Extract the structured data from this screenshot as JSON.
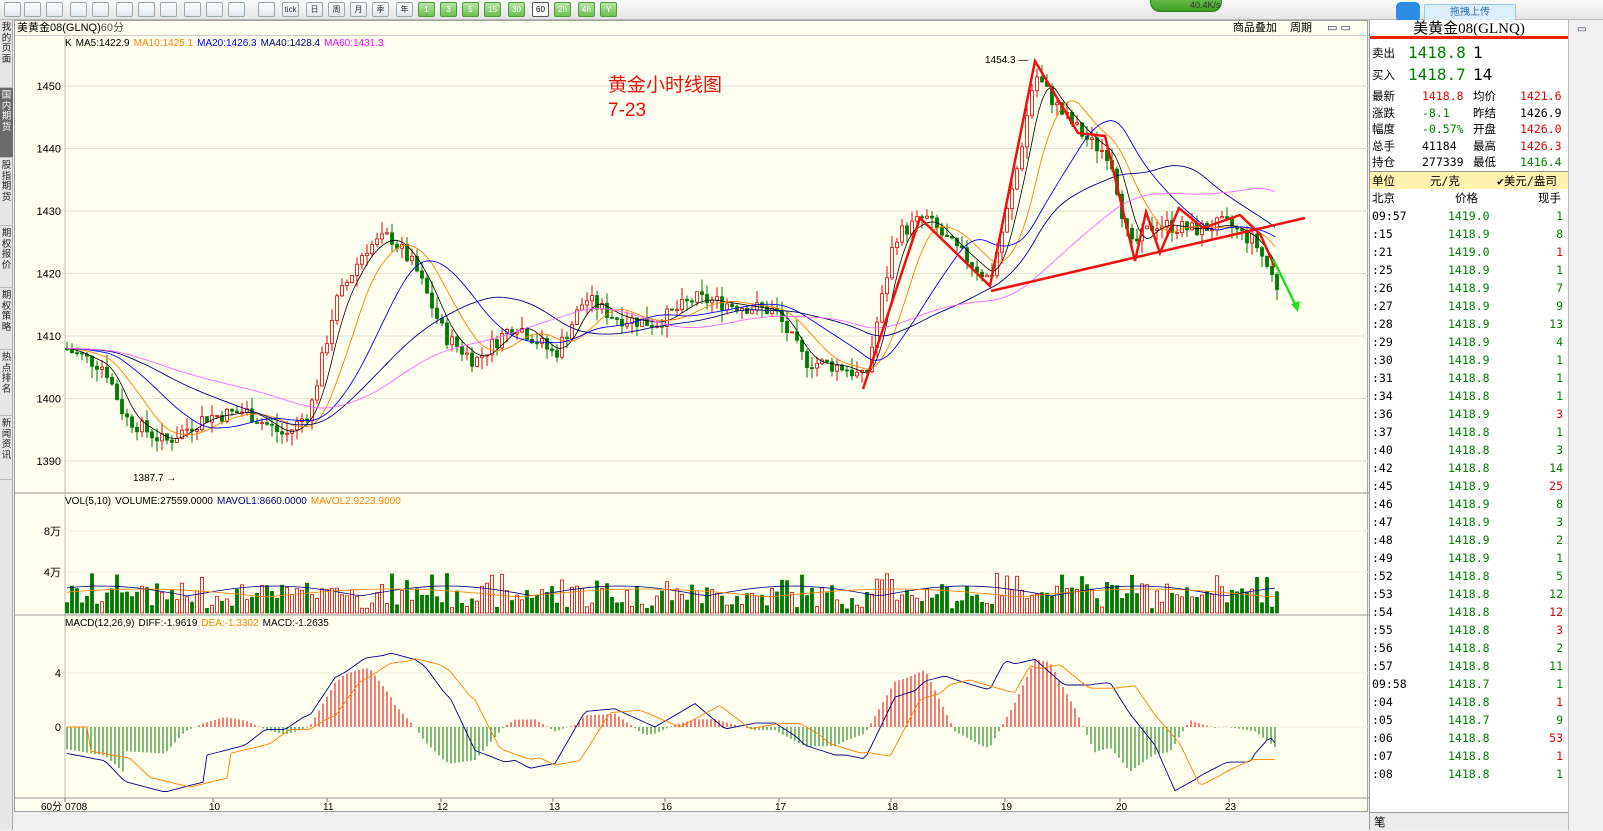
{
  "toolbar": {
    "buttons": [
      "back",
      "home",
      "page",
      "refresh",
      "zoom-in",
      "zoom-out",
      "layers",
      "draw",
      "paint",
      "filter",
      "list",
      "chart",
      "tick",
      "日",
      "周",
      "月",
      "季",
      "年",
      "1",
      "3",
      "5",
      "15",
      "30",
      "60",
      "2h",
      "4h",
      "Y"
    ],
    "speed": "40.4K/s",
    "upload": "拖拽上传"
  },
  "sidebar": [
    "我的页面",
    "国内期货",
    "股指期货",
    "期权报价",
    "期权策略",
    "热点排名",
    "新闻资讯"
  ],
  "header": {
    "title": "美黄金08(GLNQ)",
    "period": "60分",
    "right1": "商品叠加",
    "right2": "周期"
  },
  "legend_main": [
    {
      "t": "K",
      "c": "#000000"
    },
    {
      "t": "MA5:1422.9",
      "c": "#000000"
    },
    {
      "t": "MA10:1425.1",
      "c": "#ff8000"
    },
    {
      "t": "MA20:1426.3",
      "c": "#0000ff"
    },
    {
      "t": "MA40:1428.4",
      "c": "#000080"
    },
    {
      "t": "MA60:1431.3",
      "c": "#ff00ff"
    }
  ],
  "legend_vol": [
    {
      "t": "VOL(5,10)",
      "c": "#000000"
    },
    {
      "t": "VOLUME:27559.0000",
      "c": "#000000"
    },
    {
      "t": "MAVOL1:8660.0000",
      "c": "#000080"
    },
    {
      "t": "MAVOL2:9223.9000",
      "c": "#ff8000"
    }
  ],
  "legend_macd": [
    {
      "t": "MACD(12,26,9)",
      "c": "#000000"
    },
    {
      "t": "DIFF:-1.9619",
      "c": "#000000"
    },
    {
      "t": "DEA:-1.3302",
      "c": "#ff8000"
    },
    {
      "t": "MACD:-1.2635",
      "c": "#000000"
    }
  ],
  "annotation": {
    "line1": "黄金小时线图",
    "line2": "7-23"
  },
  "high_label": "1454.3",
  "low_label": "1387.7",
  "bottom_left": "60分",
  "price_axis": [
    "1450",
    "1440",
    "1430",
    "1420",
    "1410",
    "1400",
    "1390"
  ],
  "vol_axis": [
    "8万",
    "4万"
  ],
  "macd_axis": [
    "4",
    "0"
  ],
  "date_axis": [
    "0708",
    "10",
    "11",
    "12",
    "13",
    "16",
    "17",
    "18",
    "19",
    "20",
    "23"
  ],
  "panel": {
    "title": "美黄金08(GLNQ)",
    "ask_label": "卖出",
    "ask": "1418.8",
    "ask_qty": "1",
    "bid_label": "买入",
    "bid": "1418.7",
    "bid_qty": "14",
    "stats": [
      {
        "l1": "最新",
        "v1": "1418.8",
        "c1": "red",
        "l2": "均价",
        "v2": "1421.6",
        "c2": "red"
      },
      {
        "l1": "涨跌",
        "v1": "-8.1",
        "c1": "grn",
        "l2": "昨结",
        "v2": "1426.9",
        "c2": ""
      },
      {
        "l1": "幅度",
        "v1": "-0.57%",
        "c1": "grn",
        "l2": "开盘",
        "v2": "1426.0",
        "c2": "red"
      },
      {
        "l1": "总手",
        "v1": "41184",
        "c1": "",
        "l2": "最高",
        "v2": "1426.3",
        "c2": "red"
      },
      {
        "l1": "持仓",
        "v1": "277339",
        "c1": "",
        "l2": "最低",
        "v2": "1416.4",
        "c2": "grn"
      }
    ],
    "unit_label": "单位",
    "unit": "元/克",
    "unit2": "✔美元/盎司",
    "tick_head": [
      "北京",
      "价格",
      "现手"
    ],
    "ticks": [
      [
        "09:57",
        "1419.0",
        "1",
        "g"
      ],
      [
        ":15",
        "1418.9",
        "8",
        "g"
      ],
      [
        ":21",
        "1419.0",
        "1",
        "r"
      ],
      [
        ":25",
        "1418.9",
        "1",
        "g"
      ],
      [
        ":26",
        "1418.9",
        "7",
        "g"
      ],
      [
        ":27",
        "1418.9",
        "9",
        "g"
      ],
      [
        ":28",
        "1418.9",
        "13",
        "g"
      ],
      [
        ":29",
        "1418.9",
        "4",
        "g"
      ],
      [
        ":30",
        "1418.9",
        "1",
        "g"
      ],
      [
        ":31",
        "1418.8",
        "1",
        "g"
      ],
      [
        ":34",
        "1418.8",
        "1",
        "g"
      ],
      [
        ":36",
        "1418.9",
        "3",
        "r"
      ],
      [
        ":37",
        "1418.8",
        "1",
        "g"
      ],
      [
        ":40",
        "1418.8",
        "3",
        "g"
      ],
      [
        ":42",
        "1418.8",
        "14",
        "g"
      ],
      [
        ":45",
        "1418.9",
        "25",
        "r"
      ],
      [
        ":46",
        "1418.9",
        "8",
        "g"
      ],
      [
        ":47",
        "1418.9",
        "3",
        "g"
      ],
      [
        ":48",
        "1418.9",
        "2",
        "g"
      ],
      [
        ":49",
        "1418.9",
        "1",
        "g"
      ],
      [
        ":52",
        "1418.8",
        "5",
        "g"
      ],
      [
        ":53",
        "1418.8",
        "12",
        "g"
      ],
      [
        ":54",
        "1418.8",
        "12",
        "r"
      ],
      [
        ":55",
        "1418.8",
        "3",
        "r"
      ],
      [
        ":56",
        "1418.8",
        "2",
        "g"
      ],
      [
        ":57",
        "1418.8",
        "11",
        "g"
      ],
      [
        "09:58",
        "1418.7",
        "1",
        "g"
      ],
      [
        ":04",
        "1418.8",
        "1",
        "r"
      ],
      [
        ":05",
        "1418.7",
        "9",
        "g"
      ],
      [
        ":06",
        "1418.8",
        "53",
        "r"
      ],
      [
        ":07",
        "1418.8",
        "1",
        "r"
      ],
      [
        ":08",
        "1418.8",
        "1",
        "g"
      ]
    ],
    "footer": "笔"
  }
}
